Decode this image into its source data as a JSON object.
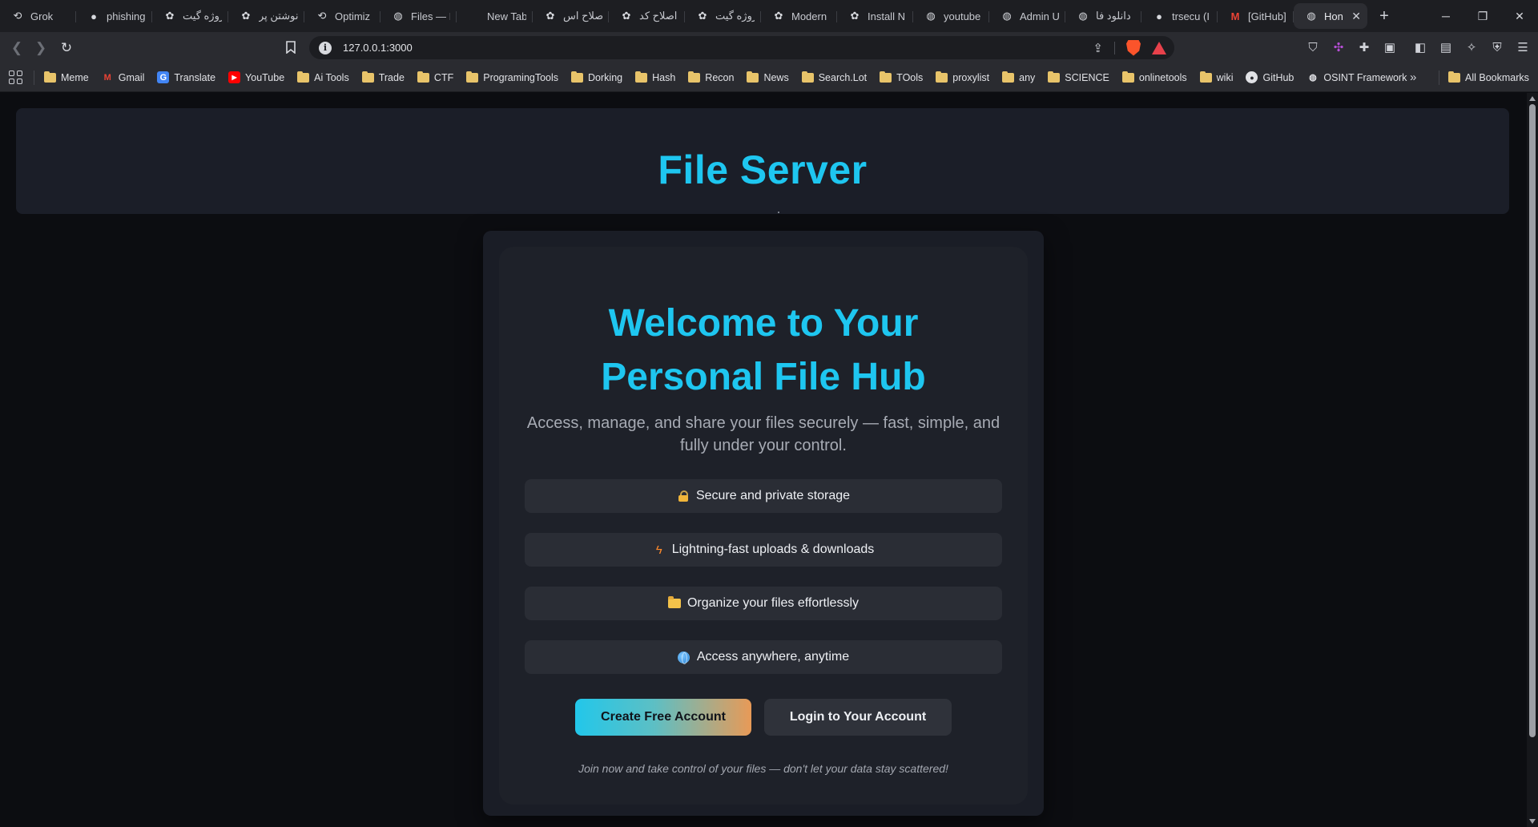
{
  "browser": {
    "tabs": [
      {
        "title": "Grok",
        "icon": "grok-icon"
      },
      {
        "title": "phishing",
        "icon": "github-icon"
      },
      {
        "title": "پروژه گیت",
        "icon": "chatgpt-icon"
      },
      {
        "title": "نوشتن پر",
        "icon": "chatgpt-icon"
      },
      {
        "title": "Optimiz",
        "icon": "grok-icon"
      },
      {
        "title": "Files — I",
        "icon": "globe-icon"
      },
      {
        "title": "New Tab",
        "icon": ""
      },
      {
        "title": "اصلاح اس",
        "icon": "chatgpt-icon"
      },
      {
        "title": "اصلاح کد",
        "icon": "chatgpt-icon"
      },
      {
        "title": "پروژه گیت",
        "icon": "chatgpt-icon"
      },
      {
        "title": "Modern",
        "icon": "chatgpt-icon"
      },
      {
        "title": "Install N",
        "icon": "chatgpt-icon"
      },
      {
        "title": "youtube",
        "icon": "globe-icon"
      },
      {
        "title": "Admin U",
        "icon": "globe-icon"
      },
      {
        "title": "دانلود فا",
        "icon": "globe-icon"
      },
      {
        "title": "trsecu (I",
        "icon": "github-icon"
      },
      {
        "title": "[GitHub]",
        "icon": "gmail-icon"
      },
      {
        "title": "Hon",
        "icon": "globe-icon",
        "active": true
      }
    ],
    "url": "127.0.0.1:3000",
    "bookmarks": [
      {
        "label": "Meme",
        "type": "folder"
      },
      {
        "label": "Gmail",
        "type": "gmail"
      },
      {
        "label": "Translate",
        "type": "translate"
      },
      {
        "label": "YouTube",
        "type": "youtube"
      },
      {
        "label": "Ai Tools",
        "type": "folder"
      },
      {
        "label": "Trade",
        "type": "folder"
      },
      {
        "label": "CTF",
        "type": "folder"
      },
      {
        "label": "ProgramingTools",
        "type": "folder"
      },
      {
        "label": "Dorking",
        "type": "folder"
      },
      {
        "label": "Hash",
        "type": "folder"
      },
      {
        "label": "Recon",
        "type": "folder"
      },
      {
        "label": "News",
        "type": "folder"
      },
      {
        "label": "Search.Lot",
        "type": "folder"
      },
      {
        "label": "TOols",
        "type": "folder"
      },
      {
        "label": "proxylist",
        "type": "folder"
      },
      {
        "label": "any",
        "type": "folder"
      },
      {
        "label": "SCIENCE",
        "type": "folder"
      },
      {
        "label": "onlinetools",
        "type": "folder"
      },
      {
        "label": "wiki",
        "type": "folder"
      },
      {
        "label": "GitHub",
        "type": "github"
      },
      {
        "label": "OSINT Framework",
        "type": "globe"
      }
    ],
    "all_bookmarks": "All Bookmarks"
  },
  "page": {
    "header_title": "File Server",
    "header_subtitle": ".",
    "hero_title": "Welcome to Your Personal File Hub",
    "hero_subtitle": "Access, manage, and share your files securely — fast, simple, and fully under your control.",
    "features": [
      {
        "text": "Secure and private storage",
        "icon": "lock-icon"
      },
      {
        "text": "Lightning-fast uploads & downloads",
        "icon": "lightning-icon"
      },
      {
        "text": "Organize your files effortlessly",
        "icon": "folder-icon"
      },
      {
        "text": "Access anywhere, anytime",
        "icon": "globe-icon"
      }
    ],
    "primary_cta": "Create Free Account",
    "secondary_cta": "Login to Your Account",
    "footer_note": "Join now and take control of your files — don't let your data stay scattered!"
  },
  "colors": {
    "accent": "#1ec6f0",
    "background": "#0c0d11",
    "card": "#1e2129",
    "cta_gradient_start": "#22c7ea",
    "cta_gradient_end": "#e89a57"
  }
}
